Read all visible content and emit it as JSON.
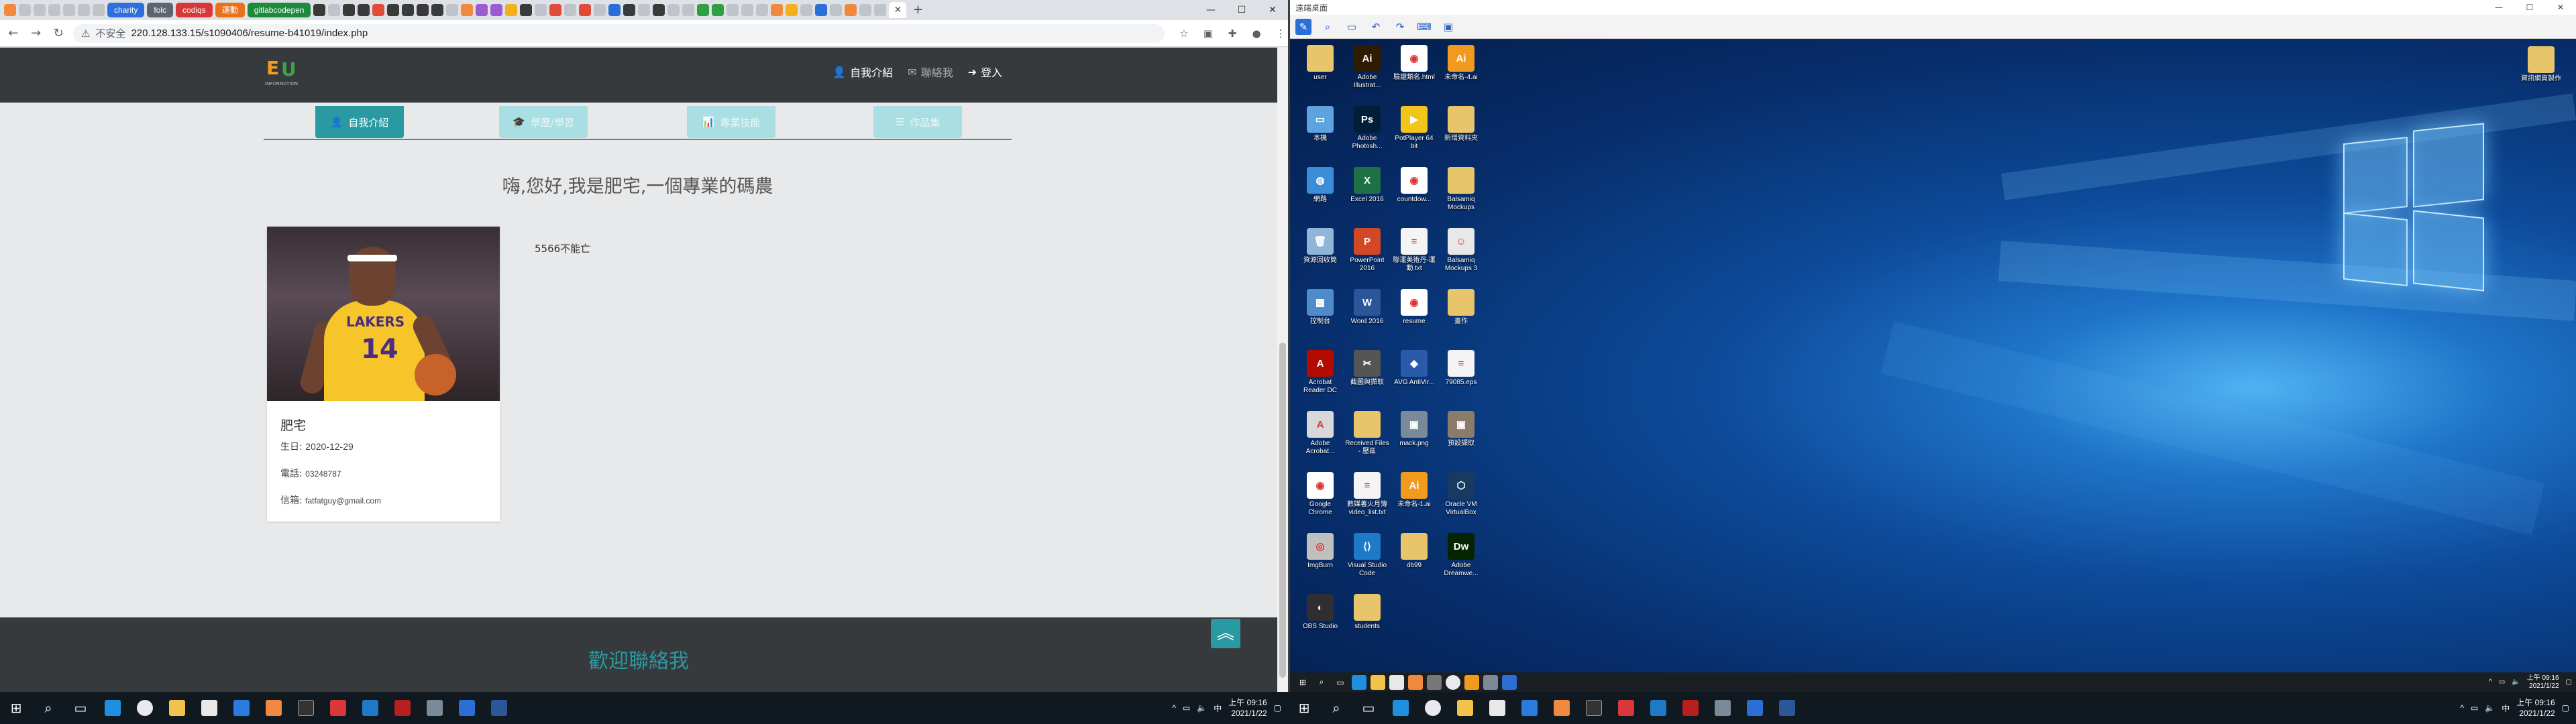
{
  "browser": {
    "bookmarks": {
      "chips": [
        {
          "label": "charity",
          "color": "blue"
        },
        {
          "label": "folc",
          "color": "grey"
        },
        {
          "label": "codiqs",
          "color": "red"
        },
        {
          "label": "運動",
          "color": "orange"
        },
        {
          "label": "gitlabcodepen",
          "color": "green"
        }
      ]
    },
    "window_controls": {
      "minimize": "—",
      "maximize": "☐",
      "close": "✕"
    },
    "new_tab": "+",
    "active_tab_close": "✕",
    "address": {
      "security_label": "不安全",
      "url": "220.128.133.15/s1090406/resume-b41019/index.php"
    }
  },
  "site": {
    "menu": {
      "about": "自我介紹",
      "contact": "聯絡我",
      "login": "登入"
    },
    "tabs": [
      {
        "label": "自我介紹",
        "icon": "👤"
      },
      {
        "label": "學歷/學習",
        "icon": "🎓"
      },
      {
        "label": "專業技能",
        "icon": "📊"
      },
      {
        "label": "作品集",
        "icon": "☰"
      }
    ],
    "heading": "嗨,您好,我是肥宅,一個專業的碼農",
    "profile": {
      "name": "肥宅",
      "birthday_label": "生日:",
      "birthday": "2020-12-29",
      "phone_label": "電話:",
      "phone": "03248787",
      "email_label": "信箱:",
      "email": "fatfatguy@gmail.com",
      "photo_number": "14",
      "photo_word": "LAKERS"
    },
    "about_text": "5566不能亡",
    "footer_title": "歡迎聯絡我",
    "back_to_top": "︽"
  },
  "local_taskbar": {
    "clock_time": "上午 09:16",
    "clock_date": "2021/1/22"
  },
  "remote": {
    "title": "遠端桌面",
    "desktop_icons": [
      {
        "label": "user",
        "color": "#e8c46a",
        "glyph": ""
      },
      {
        "label": "Adobe Illustrat...",
        "color": "#2f1c00",
        "glyph": "Ai"
      },
      {
        "label": "驗證類名.html",
        "color": "#ffffff",
        "glyph": "◉"
      },
      {
        "label": "未命名-4.ai",
        "color": "#f29a1e",
        "glyph": "Ai"
      },
      {
        "label": "本機",
        "color": "#5da4de",
        "glyph": "▭"
      },
      {
        "label": "Adobe Photosh...",
        "color": "#001e36",
        "glyph": "Ps"
      },
      {
        "label": "PotPlayer 64 bit",
        "color": "#f2c51b",
        "glyph": "▶"
      },
      {
        "label": "新增資料夾",
        "color": "#e8c46a",
        "glyph": ""
      },
      {
        "label": "網路",
        "color": "#3a8dd6",
        "glyph": "◍"
      },
      {
        "label": "Excel 2016",
        "color": "#1e7145",
        "glyph": "X"
      },
      {
        "label": "countdow...",
        "color": "#ffffff",
        "glyph": "◉"
      },
      {
        "label": "Balsamiq Mockups",
        "color": "#e8c46a",
        "glyph": ""
      },
      {
        "label": "資源回收筒",
        "color": "#8fb6d8",
        "glyph": "🗑"
      },
      {
        "label": "PowerPoint 2016",
        "color": "#d24726",
        "glyph": "P"
      },
      {
        "label": "聯運美術丹-運動.txt",
        "color": "#f4f4f4",
        "glyph": "≡"
      },
      {
        "label": "Balsamiq Mockups 3",
        "color": "#e8e8e8",
        "glyph": "☺"
      },
      {
        "label": "控制台",
        "color": "#4f8bc9",
        "glyph": "▦"
      },
      {
        "label": "Word 2016",
        "color": "#2b579a",
        "glyph": "W"
      },
      {
        "label": "resume",
        "color": "#ffffff",
        "glyph": "◉"
      },
      {
        "label": "畫作",
        "color": "#e8c46a",
        "glyph": ""
      },
      {
        "label": "Acrobat Reader DC",
        "color": "#b30b00",
        "glyph": "A"
      },
      {
        "label": "截圖與擷取",
        "color": "#555555",
        "glyph": "✂"
      },
      {
        "label": "AVG AntiVir...",
        "color": "#2a5ba8",
        "glyph": "◆"
      },
      {
        "label": "79085.eps",
        "color": "#f4f4f4",
        "glyph": "≡"
      },
      {
        "label": "Adobe Acrobat...",
        "color": "#d8d8d8",
        "glyph": "A"
      },
      {
        "label": "Received Files - 壓區",
        "color": "#e8c46a",
        "glyph": ""
      },
      {
        "label": "mack.png",
        "color": "#7a8a99",
        "glyph": "▣"
      },
      {
        "label": "預設擷取",
        "color": "#8b7b6b",
        "glyph": "▣"
      },
      {
        "label": "Google Chrome",
        "color": "#ffffff",
        "glyph": "◉"
      },
      {
        "label": "數媒著火月簿 video_list.txt",
        "color": "#f4f4f4",
        "glyph": "≡"
      },
      {
        "label": "未命名-1.ai",
        "color": "#f29a1e",
        "glyph": "Ai"
      },
      {
        "label": "Oracle VM VirtualBox",
        "color": "#183a61",
        "glyph": "⬡"
      },
      {
        "label": "ImgBurn",
        "color": "#c0c0c0",
        "glyph": "◎"
      },
      {
        "label": "Visual Studio Code",
        "color": "#1e79c6",
        "glyph": "⟨⟩"
      },
      {
        "label": "db99",
        "color": "#e8c46a",
        "glyph": ""
      },
      {
        "label": "Adobe Dreamwe...",
        "color": "#072401",
        "glyph": "Dw"
      },
      {
        "label": "OBS Studio",
        "color": "#302e31",
        "glyph": "◐"
      },
      {
        "label": "students",
        "color": "#e8c46a",
        "glyph": ""
      }
    ],
    "corner_folder": {
      "label": "資訊網頁製作",
      "color": "#e8c46a"
    },
    "inner_taskbar": {
      "clock_time": "上午 09:16",
      "clock_date": "2021/1/22"
    },
    "outer_taskbar": {
      "clock_time": "上午 09:16",
      "clock_date": "2021/1/22"
    }
  }
}
